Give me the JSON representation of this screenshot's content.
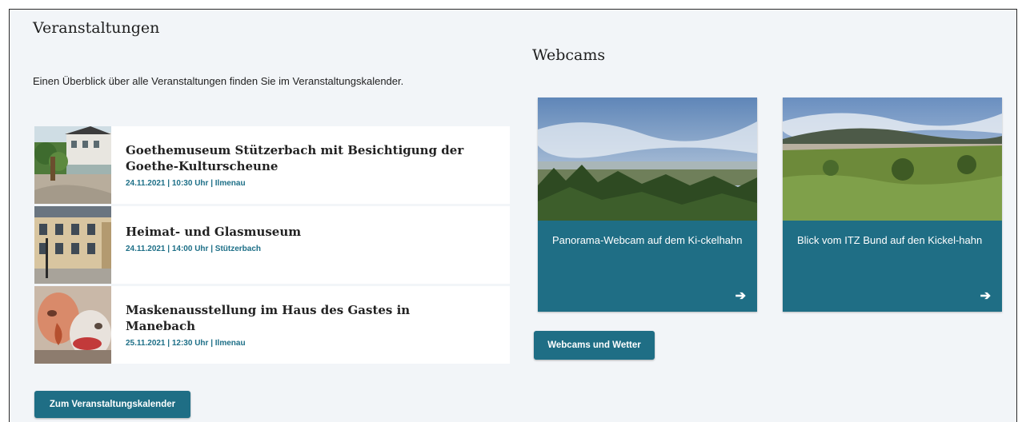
{
  "events": {
    "title": "Veranstaltungen",
    "intro": "Einen Überblick über alle Veranstaltungen finden Sie im Veranstaltungskalender.",
    "items": [
      {
        "title": "Goethemuseum Stützerbach mit Besichtigung der Goethe-Kulturscheune",
        "meta": "24.11.2021 | 10:30 Uhr | Ilmenau",
        "image": "museum-house-photo"
      },
      {
        "title": "Heimat- und Glasmuseum",
        "meta": "24.11.2021 | 14:00 Uhr | Stützerbach",
        "image": "museum-building-photo"
      },
      {
        "title": "Maskenausstellung im Haus des Gastes in Manebach",
        "meta": "25.11.2021 | 12:30 Uhr | Ilmenau",
        "image": "masks-photo"
      }
    ],
    "calendar_button": "Zum Veranstaltungskalender"
  },
  "webcams": {
    "title": "Webcams",
    "items": [
      {
        "title": "Panorama-Webcam auf dem Ki-ckelhahn",
        "image": "panorama-landscape-photo",
        "arrow": "➔"
      },
      {
        "title": "Blick vom ITZ Bund auf den Kickel-hahn",
        "image": "hills-landscape-photo",
        "arrow": "➔"
      }
    ],
    "button": "Webcams und Wetter"
  },
  "colors": {
    "accent": "#1f6e85",
    "meta": "#1d6f87",
    "background": "#f2f5f8"
  }
}
